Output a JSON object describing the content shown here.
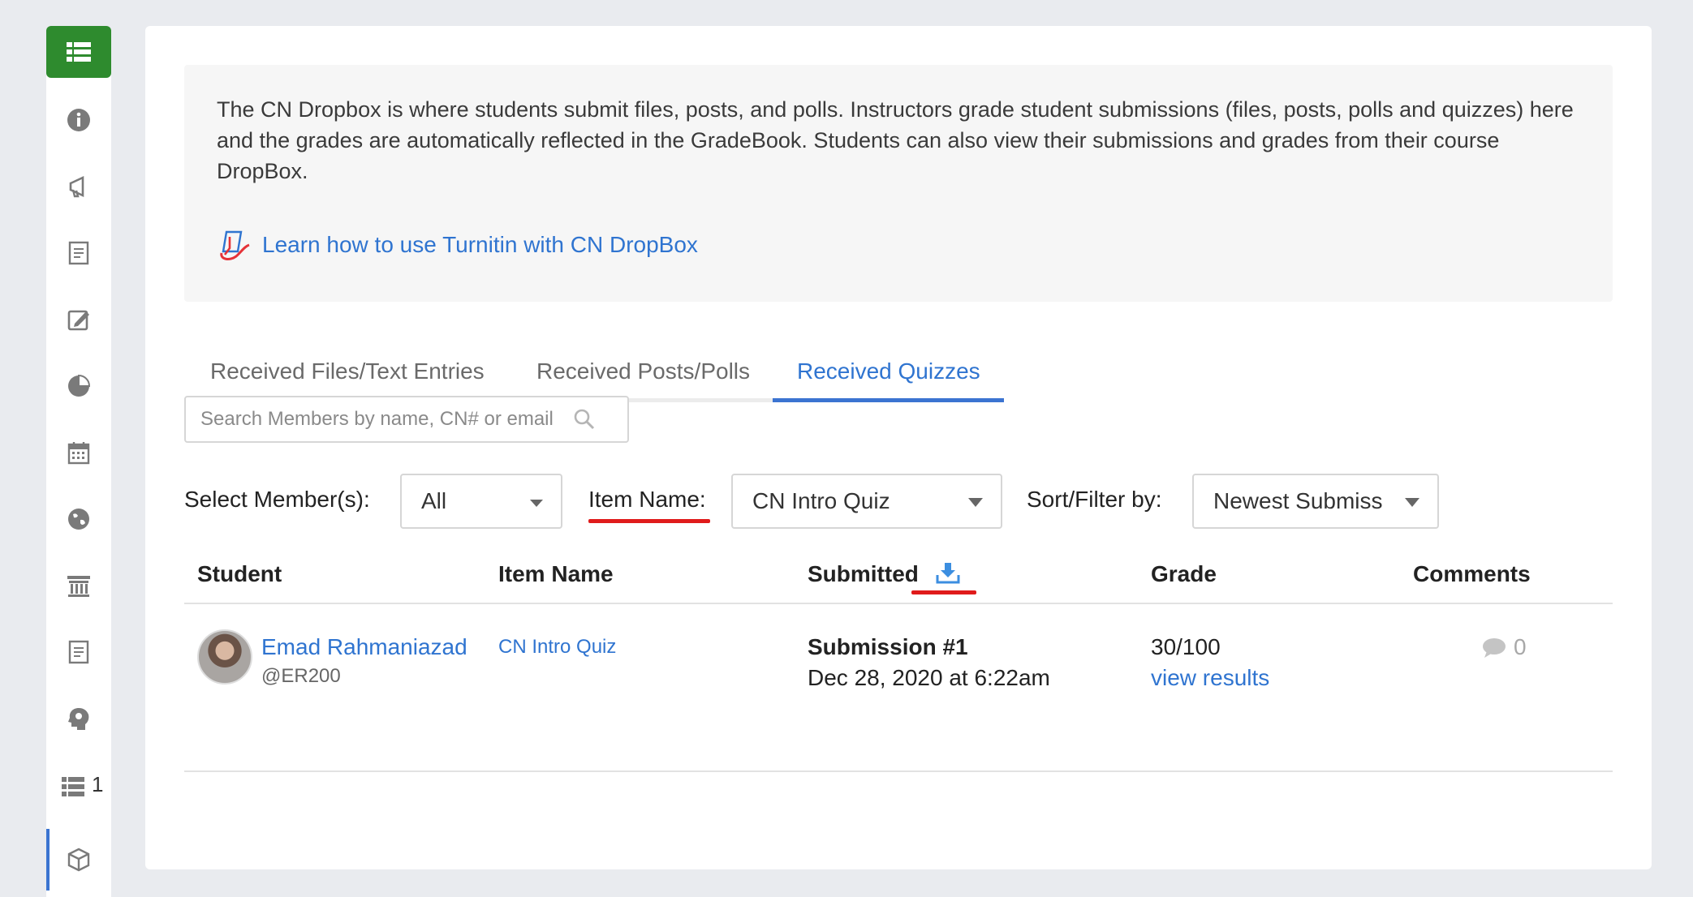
{
  "intro": {
    "text": "The CN Dropbox is where students submit files, posts, and polls. Instructors grade student submissions (files, posts, polls and quizzes) here and the grades are automatically reflected in the GradeBook. Students can also view their submissions and grades from their course DropBox.",
    "turnitin_link": "Learn how to use Turnitin with CN DropBox"
  },
  "tabs": [
    {
      "label": "Received Files/Text Entries"
    },
    {
      "label": "Received Posts/Polls"
    },
    {
      "label": "Received Quizzes"
    }
  ],
  "search": {
    "placeholder": "Search Members by name, CN# or email"
  },
  "filters": {
    "members_label": "Select Member(s):",
    "members_value": "All",
    "item_label": "Item Name:",
    "item_value": "CN Intro Quiz",
    "sort_label": "Sort/Filter by:",
    "sort_value": "Newest Submiss"
  },
  "table": {
    "headers": {
      "student": "Student",
      "item": "Item Name",
      "submitted": "Submitted",
      "grade": "Grade",
      "comments": "Comments"
    },
    "rows": [
      {
        "name": "Emad Rahmaniazad",
        "handle": "@ER200",
        "item": "CN Intro Quiz",
        "submission": "Submission #1",
        "date": "Dec 28, 2020 at 6:22am",
        "grade": "30/100",
        "view": "view results",
        "comments": "0"
      }
    ]
  },
  "sidebar": {
    "list_count": "1"
  },
  "colors": {
    "brand_green": "#2e8b2e",
    "link_blue": "#2f74d0",
    "highlight_red": "#e01b1b"
  }
}
